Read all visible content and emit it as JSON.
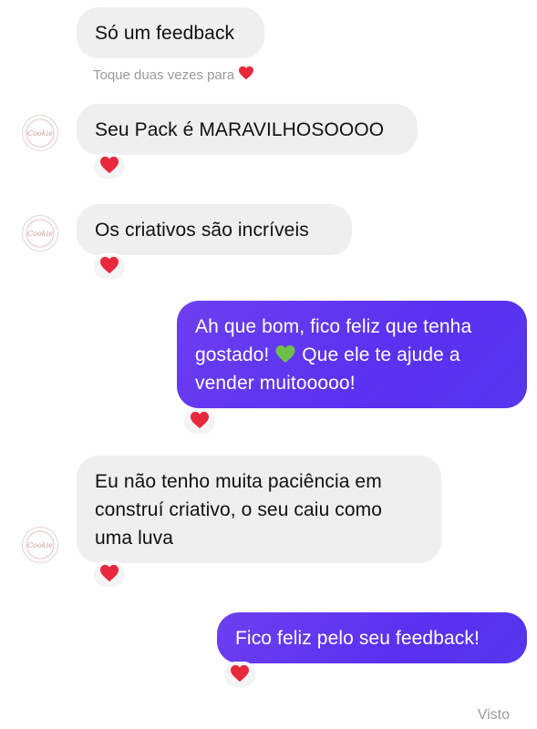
{
  "messages": [
    {
      "text": "Só um feedback"
    },
    {
      "text": "Seu Pack é MARAVILHOSOOOO"
    },
    {
      "text": "Os criativos são incríveis"
    },
    {
      "text_before": "Ah que bom, fico feliz que tenha\ngostado! ",
      "text_after": " Que ele te ajude a\nvender muitooooo!"
    },
    {
      "text": "Eu não tenho muita paciência em\nconstruí criativo, o seu caiu como\numa luva"
    },
    {
      "text": "Fico feliz pelo seu feedback!"
    }
  ],
  "hint_text": "Toque duas vezes para",
  "seen_text": "Visto",
  "avatar_text": "Cookie",
  "colors": {
    "incoming_bubble": "#efefef",
    "outgoing_bubble": "#5a31f0",
    "heart": "#e8283c",
    "green_heart": "#6cc04a"
  },
  "icons": [
    "heart-icon",
    "green-heart-icon",
    "avatar-logo-icon"
  ]
}
